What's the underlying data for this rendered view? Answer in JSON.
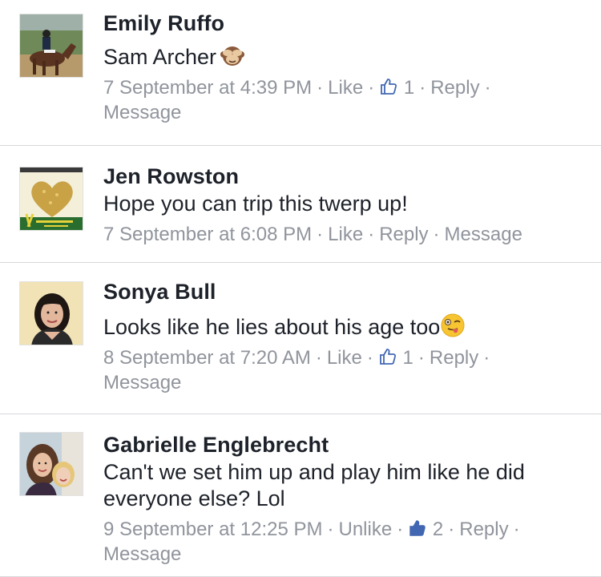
{
  "comments": [
    {
      "author": "Emily Ruffo",
      "text": "Sam Archer",
      "emoji": "see-no-evil-monkey",
      "timestamp": "7 September at 4:39 PM",
      "like_label": "Like",
      "like_count": "1",
      "reply_label": "Reply",
      "message_label": "Message",
      "avatar": "horse-rider-photo"
    },
    {
      "author": "Jen Rowston",
      "text": "Hope you can trip this twerp up!",
      "timestamp": "7 September at 6:08 PM",
      "like_label": "Like",
      "reply_label": "Reply",
      "message_label": "Message",
      "avatar": "gold-ribbon-heart-graphic"
    },
    {
      "author": "Sonya Bull",
      "text": "Looks like he lies about his age too",
      "emoji": "winking-tongue-face",
      "timestamp": "8 September at 7:20 AM",
      "like_label": "Like",
      "like_count": "1",
      "reply_label": "Reply",
      "message_label": "Message",
      "avatar": "woman-portrait-photo"
    },
    {
      "author": "Gabrielle Englebrecht",
      "text": "Can't we set him up and play him like he did everyone else? Lol",
      "timestamp": "9 September at 12:25 PM",
      "like_label": "Unlike",
      "like_count": "2",
      "reply_label": "Reply",
      "message_label": "Message",
      "avatar": "mother-child-photo"
    }
  ],
  "colors": {
    "name_text": "#1d2129",
    "body_text": "#1d2129",
    "meta_text": "#90949c",
    "like_icon_outline": "#90949c",
    "liked_icon_blue": "#4267b2",
    "divider": "#d8d8dc"
  }
}
